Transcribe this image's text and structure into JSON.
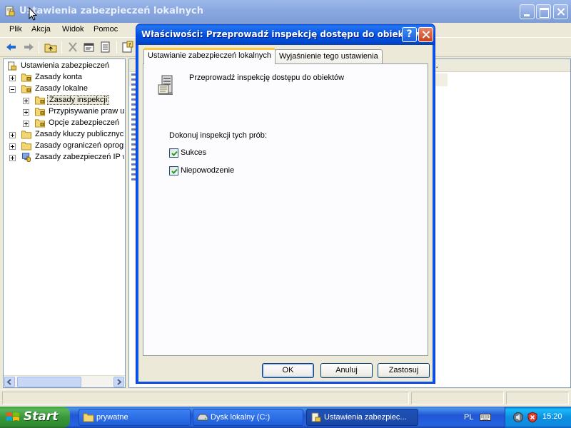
{
  "main_window": {
    "title": "Ustawienia zabezpieczeń lokalnych",
    "menu": [
      "Plik",
      "Akcja",
      "Widok",
      "Pomoc"
    ],
    "list_header_more": ".."
  },
  "tree": {
    "root": "Ustawienia zabezpieczeń",
    "items": [
      {
        "label": "Zasady konta"
      },
      {
        "label": "Zasady lokalne"
      },
      {
        "label": "Zasady inspekcji"
      },
      {
        "label": "Przypisywanie praw uż"
      },
      {
        "label": "Opcje zabezpieczeń"
      },
      {
        "label": "Zasady kluczy publicznych"
      },
      {
        "label": "Zasady ograniczeń oprogr"
      },
      {
        "label": "Zasady zabezpieczeń IP w"
      }
    ]
  },
  "dialog": {
    "title": "Właściwości: Przeprowadź inspekcję dostępu do obiektów",
    "help_label": "?",
    "tabs": [
      "Ustawianie zabezpieczeń lokalnych",
      "Wyjaśnienie tego ustawienia"
    ],
    "policy_name": "Przeprowadź inspekcję dostępu do obiektów",
    "audit_label": "Dokonuj inspekcji tych prób:",
    "checkboxes": [
      {
        "label": "Sukces",
        "checked": true
      },
      {
        "label": "Niepowodzenie",
        "checked": true
      }
    ],
    "buttons": {
      "ok": "OK",
      "cancel": "Anuluj",
      "apply": "Zastosuj"
    }
  },
  "taskbar": {
    "start_label": "Start",
    "tasks": [
      {
        "label": "prywatne",
        "icon": "folder-icon"
      },
      {
        "label": "Dysk lokalny (C:)",
        "icon": "drive-icon"
      },
      {
        "label": "Ustawienia zabezpiec...",
        "icon": "security-settings-icon",
        "active": true
      }
    ],
    "language": "PL",
    "clock": "15:20"
  },
  "colors": {
    "dialog_title_blue": "#0a55e3",
    "inactive_title_blue": "#8aa8e0",
    "taskbar_blue": "#2157d7",
    "start_green": "#3b973b",
    "face": "#ece9d8"
  }
}
